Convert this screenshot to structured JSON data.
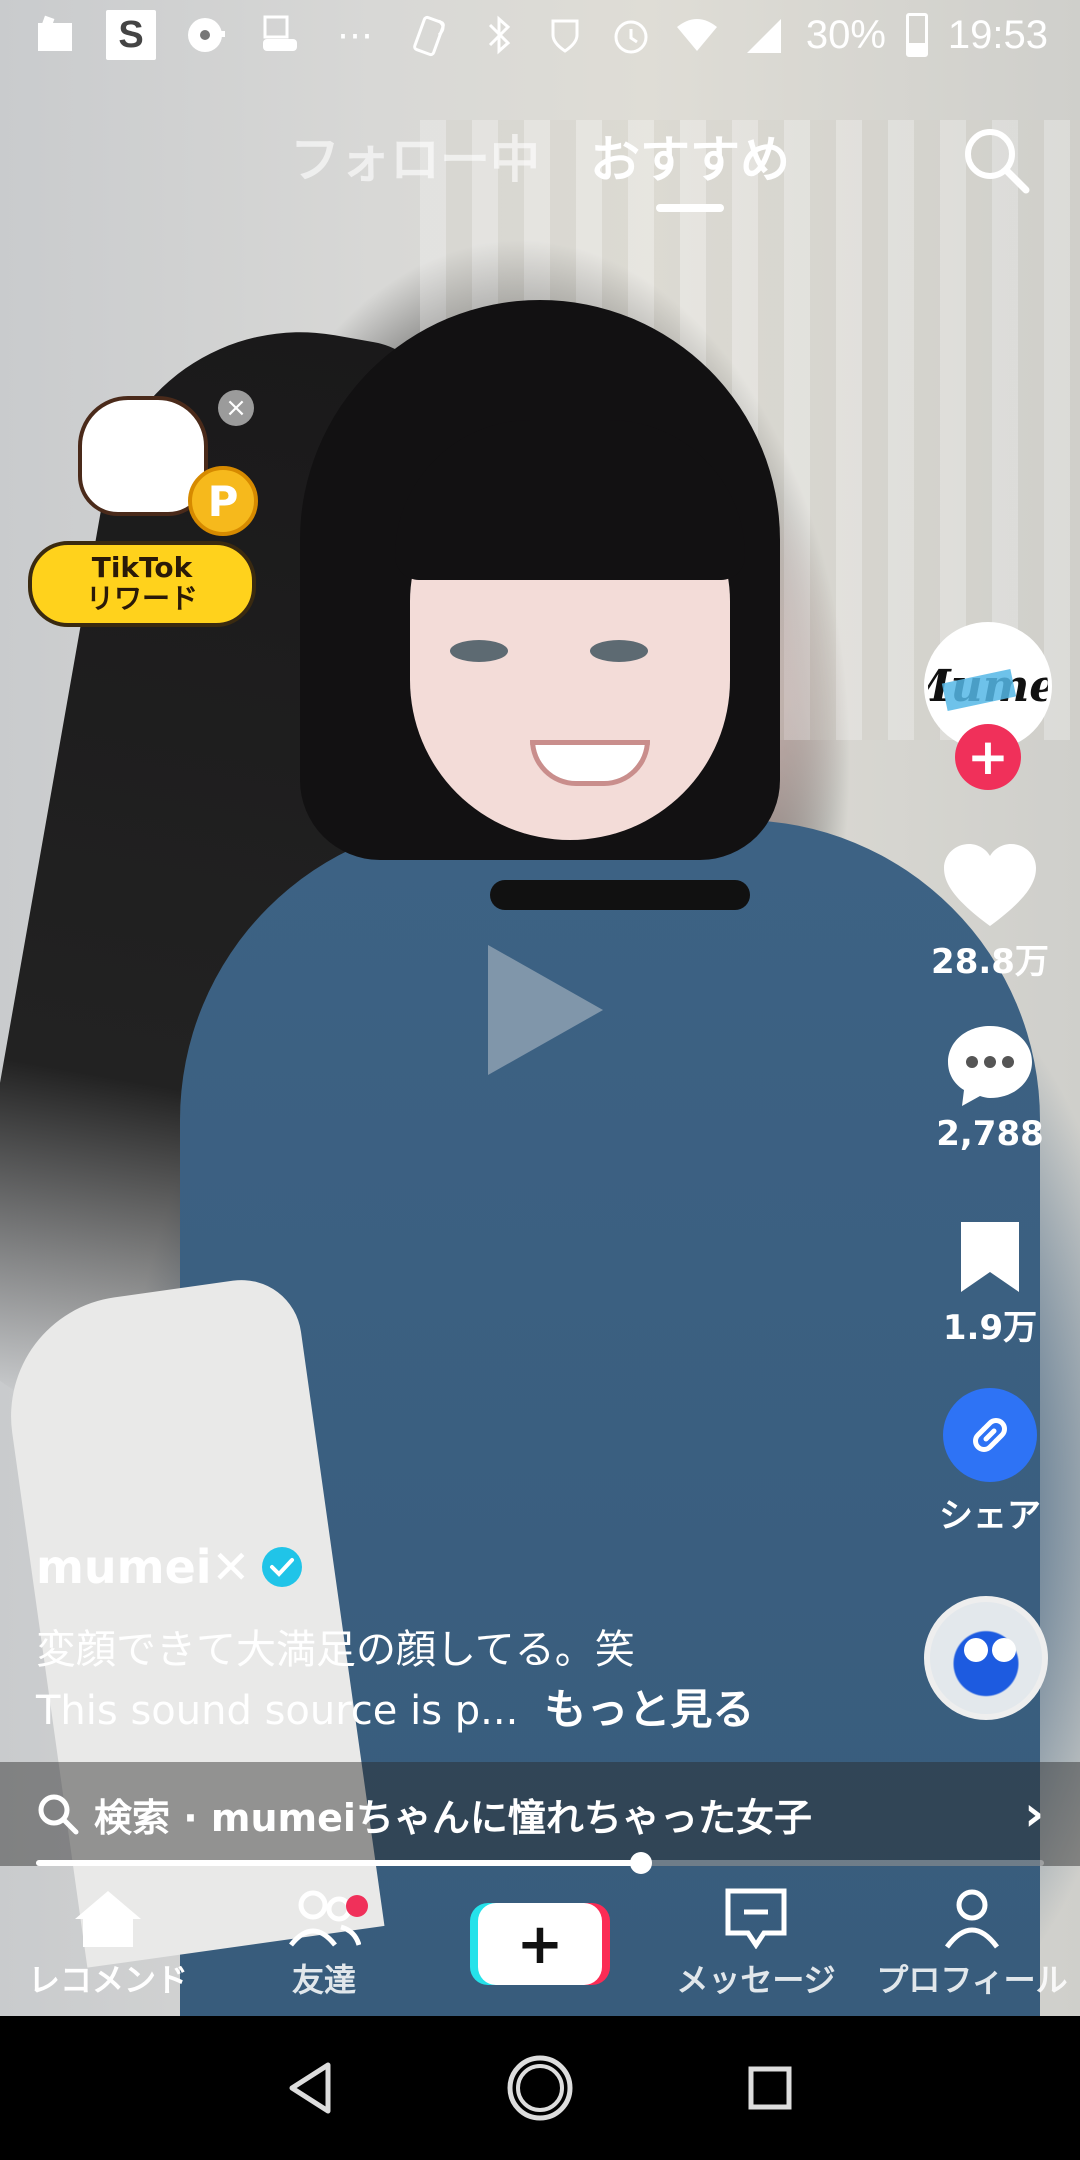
{
  "status_bar": {
    "battery": "30%",
    "time": "19:53",
    "ellipsis": "⋯",
    "s_icon": "S"
  },
  "top_tabs": {
    "following": "フォロー中",
    "for_you": "おすすめ"
  },
  "reward": {
    "line1": "TikTok",
    "line2": "リワード",
    "coin": "P",
    "close": "×"
  },
  "creator": {
    "avatar_text": "Mumei",
    "username": "mumei✕",
    "follow_plus": "+"
  },
  "actions": {
    "likes": "28.8万",
    "comments": "2,788",
    "saves": "1.9万",
    "share": "シェア"
  },
  "caption": {
    "text": "変顔できて大満足の顔してる。笑",
    "sound": "This sound source is p...",
    "more": "もっと見る"
  },
  "search_suggestion": {
    "text": "検索 · mumeiちゃんに憧れちゃった女子",
    "chevron": "›"
  },
  "playback": {
    "progress": 0.6
  },
  "bottom_nav": {
    "home": "レコメンド",
    "friends": "友達",
    "create": "+",
    "inbox": "メッセージ",
    "profile": "プロフィール"
  }
}
